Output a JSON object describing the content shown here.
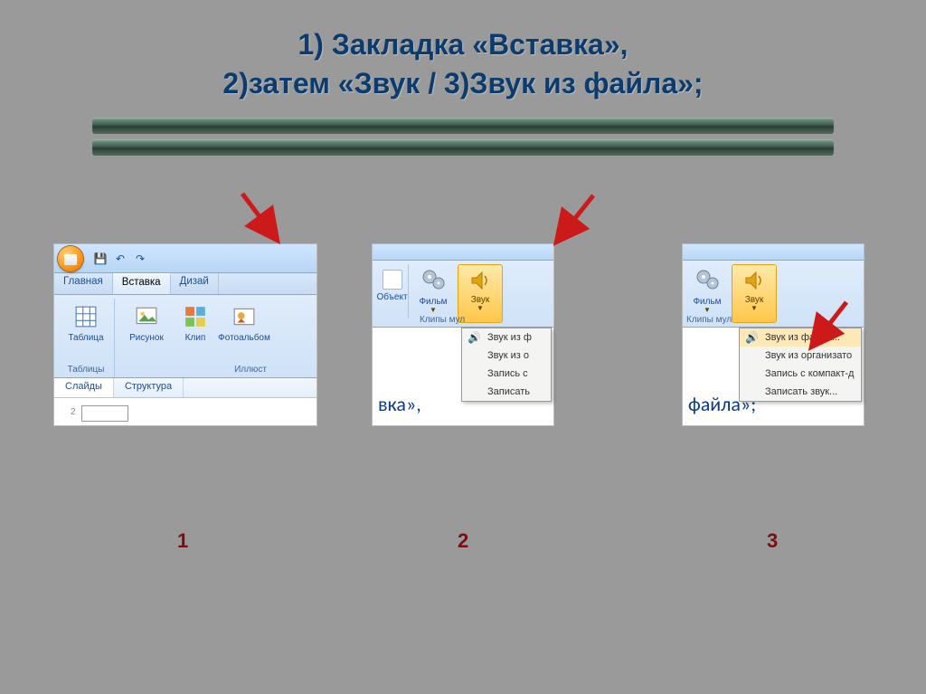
{
  "title_line1": "1) Закладка «Вставка»,",
  "title_line2": "2)затем  «Звук / 3)Звук из файла»;",
  "fig1": {
    "tabs": [
      "Главная",
      "Вставка",
      "Дизай"
    ],
    "active_tab": 1,
    "group_table_label": "Таблицы",
    "group_ill_label": "Иллюст",
    "btn_table": "Таблица",
    "btn_pic": "Рисунок",
    "btn_clip": "Клип",
    "btn_album": "Фотоальбом",
    "panel_tabs": [
      "Слайды",
      "Структура"
    ],
    "slide_num": "2"
  },
  "fig2": {
    "btn_object": "Объект",
    "btn_movie": "Фильм",
    "btn_sound": "Звук",
    "group_label": "Клипы мул",
    "dd_items": [
      "Звук из ф",
      "Звук из о",
      "Запись с",
      "Записать"
    ],
    "text_under": "вка»,"
  },
  "fig3": {
    "btn_movie": "Фильм",
    "btn_sound": "Звук",
    "group_label": "Клипы мул",
    "dd_items": [
      "Звук из файла...",
      "Звук из организато",
      "Запись с компакт-д",
      "Записать звук..."
    ],
    "text_under": "файла»;"
  },
  "labels": {
    "n1": "1",
    "n2": "2",
    "n3": "3"
  }
}
